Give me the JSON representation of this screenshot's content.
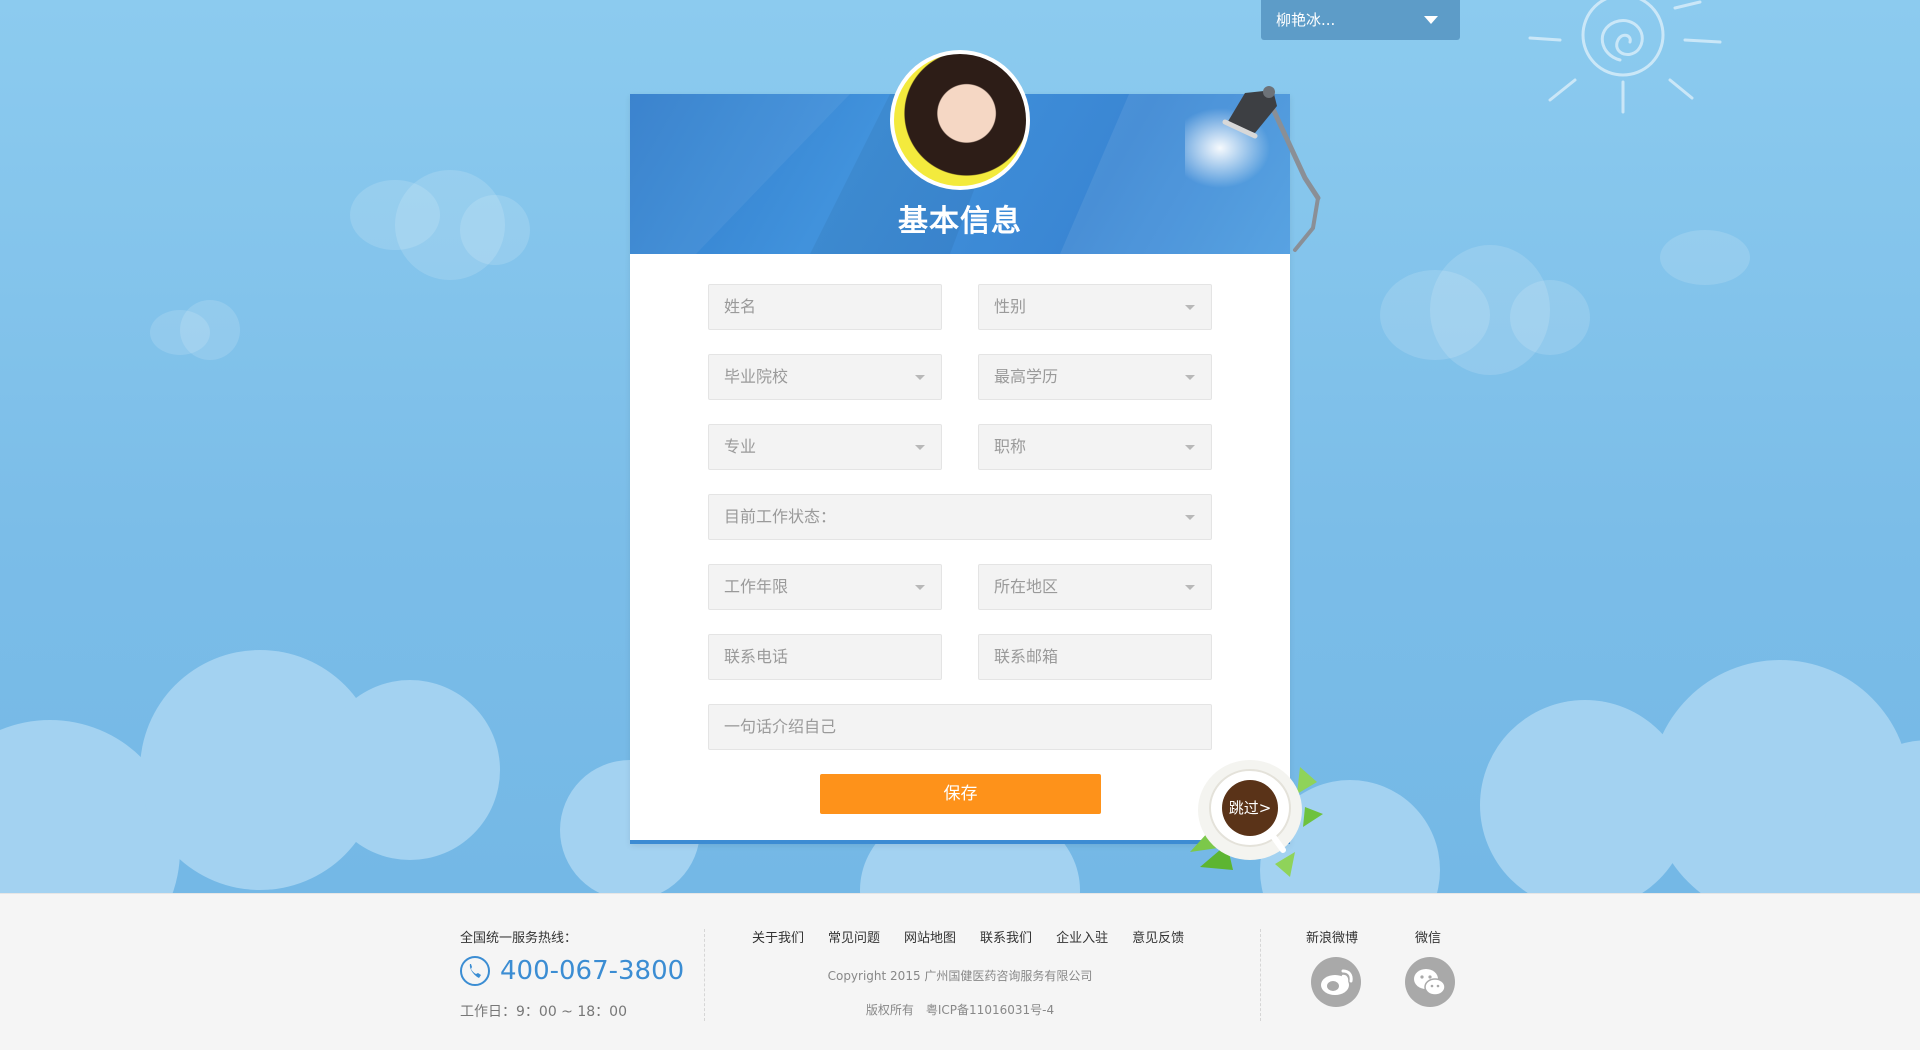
{
  "user_menu": {
    "name": "柳艳冰..."
  },
  "header": {
    "title": "基本信息"
  },
  "form": {
    "name_placeholder": "姓名",
    "gender_placeholder": "性别",
    "school_placeholder": "毕业院校",
    "education_placeholder": "最高学历",
    "major_placeholder": "专业",
    "title_placeholder": "职称",
    "work_status_placeholder": "目前工作状态：",
    "work_years_placeholder": "工作年限",
    "region_placeholder": "所在地区",
    "phone_placeholder": "联系电话",
    "email_placeholder": "联系邮箱",
    "intro_placeholder": "一句话介绍自己",
    "save_label": "保存",
    "skip_label": "跳过>"
  },
  "footer": {
    "hotline_label": "全国统一服务热线：",
    "hotline_number": "400-067-3800",
    "hours": "工作日：9：00 ~ 18：00",
    "links": [
      "关于我们",
      "常见问题",
      "网站地图",
      "联系我们",
      "企业入驻",
      "意见反馈"
    ],
    "copyright": "Copyright 2015 广州国健医药咨询服务有限公司",
    "icp": "版权所有　粤ICP备11016031号-4",
    "weibo_label": "新浪微博",
    "wechat_label": "微信"
  },
  "colors": {
    "sky": "#85c4ec",
    "header_blue": "#3a86d3",
    "accent_orange": "#fe921a",
    "footer_bg": "#f5f5f5",
    "hotline_blue": "#3b8dd3"
  },
  "icons": [
    "caret-down-icon",
    "lamp-icon",
    "coffee-cup-icon",
    "phone-icon",
    "weibo-icon",
    "wechat-icon",
    "sun-icon"
  ]
}
